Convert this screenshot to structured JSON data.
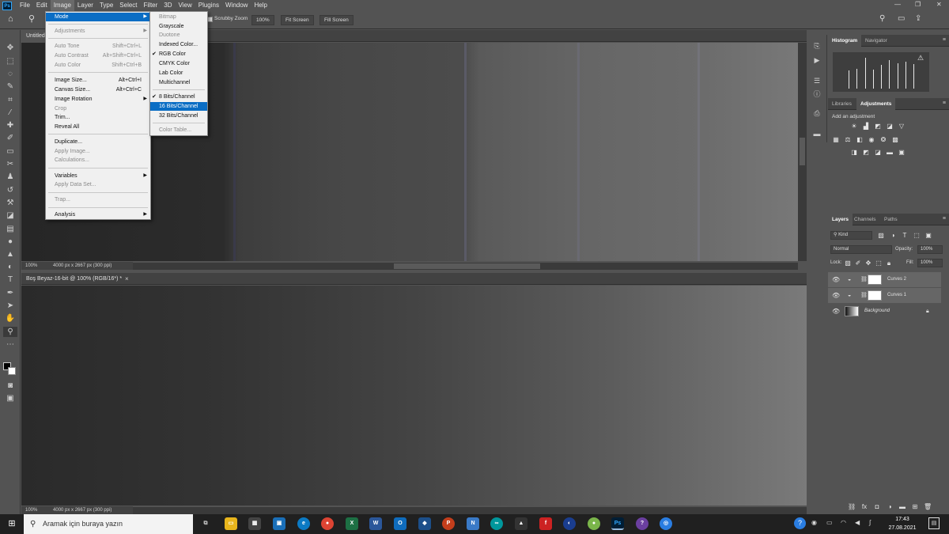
{
  "menubar": {
    "logo": "Ps",
    "items": [
      "File",
      "Edit",
      "Image",
      "Layer",
      "Type",
      "Select",
      "Filter",
      "3D",
      "View",
      "Plugins",
      "Window",
      "Help"
    ],
    "active": "Image",
    "controls": {
      "minimize": "—",
      "restore": "❐",
      "close": "✕"
    }
  },
  "options_bar": {
    "scrubby_zoom": "Scrubby Zoom",
    "zoom_percent": "100%",
    "fit_screen": "Fit Screen",
    "fill_screen": "Fill Screen"
  },
  "image_menu": {
    "items": [
      {
        "label": "Mode",
        "shortcut": "",
        "submenu": true,
        "disabled": false,
        "highlighted": true
      },
      {
        "label": "Adjustments",
        "shortcut": "",
        "submenu": true,
        "disabled": true
      },
      {
        "label": "Auto Tone",
        "shortcut": "Shift+Ctrl+L",
        "disabled": true
      },
      {
        "label": "Auto Contrast",
        "shortcut": "Alt+Shift+Ctrl+L",
        "disabled": true
      },
      {
        "label": "Auto Color",
        "shortcut": "Shift+Ctrl+B",
        "disabled": true
      },
      {
        "label": "Image Size...",
        "shortcut": "Alt+Ctrl+I",
        "disabled": false
      },
      {
        "label": "Canvas Size...",
        "shortcut": "Alt+Ctrl+C",
        "disabled": false
      },
      {
        "label": "Image Rotation",
        "shortcut": "",
        "submenu": true,
        "disabled": false
      },
      {
        "label": "Crop",
        "shortcut": "",
        "disabled": true
      },
      {
        "label": "Trim...",
        "shortcut": "",
        "disabled": false
      },
      {
        "label": "Reveal All",
        "shortcut": "",
        "disabled": false
      },
      {
        "label": "Duplicate...",
        "shortcut": "",
        "disabled": false
      },
      {
        "label": "Apply Image...",
        "shortcut": "",
        "disabled": true
      },
      {
        "label": "Calculations...",
        "shortcut": "",
        "disabled": true
      },
      {
        "label": "Variables",
        "shortcut": "",
        "submenu": true,
        "disabled": false
      },
      {
        "label": "Apply Data Set...",
        "shortcut": "",
        "disabled": true
      },
      {
        "label": "Trap...",
        "shortcut": "",
        "disabled": true
      },
      {
        "label": "Analysis",
        "shortcut": "",
        "submenu": true,
        "disabled": false
      }
    ]
  },
  "mode_submenu": {
    "items": [
      {
        "label": "Bitmap",
        "disabled": true,
        "checked": false
      },
      {
        "label": "Grayscale",
        "disabled": false,
        "checked": false
      },
      {
        "label": "Duotone",
        "disabled": true,
        "checked": false
      },
      {
        "label": "Indexed Color...",
        "disabled": false,
        "checked": false
      },
      {
        "label": "RGB Color",
        "disabled": false,
        "checked": true
      },
      {
        "label": "CMYK Color",
        "disabled": false,
        "checked": false
      },
      {
        "label": "Lab Color",
        "disabled": false,
        "checked": false
      },
      {
        "label": "Multichannel",
        "disabled": false,
        "checked": false
      },
      {
        "label": "8 Bits/Channel",
        "disabled": false,
        "checked": true
      },
      {
        "label": "16 Bits/Channel",
        "disabled": false,
        "checked": false,
        "highlighted": true
      },
      {
        "label": "32 Bits/Channel",
        "disabled": false,
        "checked": false
      },
      {
        "label": "Color Table...",
        "disabled": true,
        "checked": false
      }
    ]
  },
  "documents": {
    "doc1": {
      "tab": "Untitled",
      "zoom": "100%",
      "info": "4000 px x 2667 px (300 ppi)"
    },
    "doc2": {
      "tab": "Boş Beyaz-16-bit @ 100% (RGB/16*) *",
      "close": "×",
      "zoom": "100%",
      "info": "4000 px x 2667 px (300 ppi)"
    }
  },
  "panels": {
    "top_tabs": [
      "Histogram",
      "Navigator"
    ],
    "top_active": "Histogram",
    "mid_tabs": [
      "Libraries",
      "Adjustments"
    ],
    "mid_active": "Adjustments",
    "add_adjustment": "Add an adjustment",
    "layers_tabs": [
      "Layers",
      "Channels",
      "Paths"
    ],
    "layers_active": "Layers",
    "filter_kind": "Kind",
    "blend_mode": "Normal",
    "opacity_label": "Opacity:",
    "opacity_value": "100%",
    "lock_label": "Lock:",
    "fill_label": "Fill:",
    "fill_value": "100%",
    "layers": [
      {
        "name": "Curves 2",
        "selected": true
      },
      {
        "name": "Curves 1",
        "selected": true
      },
      {
        "name": "Background",
        "selected": false
      }
    ]
  },
  "taskbar": {
    "search_placeholder": "Aramak için buraya yazın",
    "time": "17:43",
    "date": "27.08.2021"
  },
  "histogram_levels": [
    0.58,
    0.62,
    0.98,
    0.6,
    0.75,
    0.9,
    0.8,
    0.86,
    0.78
  ]
}
